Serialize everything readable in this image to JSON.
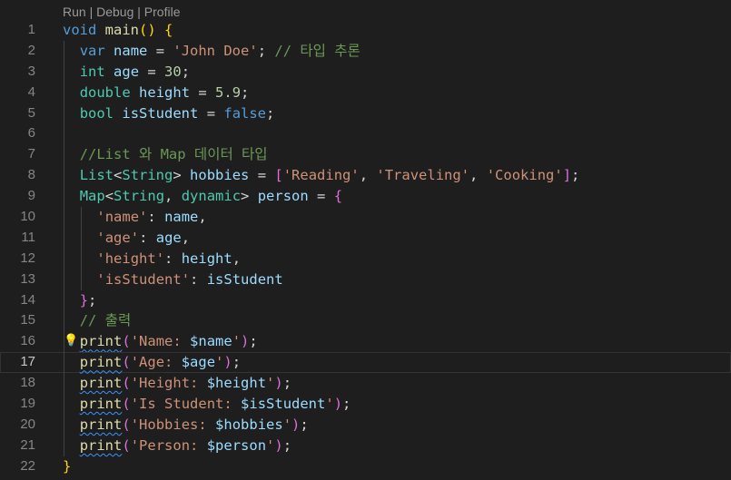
{
  "codelens": {
    "run": "Run",
    "debug": "Debug",
    "profile": "Profile",
    "sep": " | "
  },
  "current_line": 17,
  "lines": [
    {
      "n": "1",
      "tokens": [
        [
          "kw",
          "void"
        ],
        [
          "pu",
          " "
        ],
        [
          "fn",
          "main"
        ],
        [
          "br1",
          "()"
        ],
        [
          "pu",
          " "
        ],
        [
          "br1",
          "{"
        ]
      ]
    },
    {
      "n": "2",
      "indent": 1,
      "tokens": [
        [
          "kw",
          "var"
        ],
        [
          "pu",
          " "
        ],
        [
          "va",
          "name"
        ],
        [
          "pu",
          " = "
        ],
        [
          "st",
          "'John Doe'"
        ],
        [
          "pu",
          "; "
        ],
        [
          "cm",
          "// 타입 추론"
        ]
      ]
    },
    {
      "n": "3",
      "indent": 1,
      "tokens": [
        [
          "ty",
          "int"
        ],
        [
          "pu",
          " "
        ],
        [
          "va",
          "age"
        ],
        [
          "pu",
          " = "
        ],
        [
          "nu",
          "30"
        ],
        [
          "pu",
          ";"
        ]
      ]
    },
    {
      "n": "4",
      "indent": 1,
      "tokens": [
        [
          "ty",
          "double"
        ],
        [
          "pu",
          " "
        ],
        [
          "va",
          "height"
        ],
        [
          "pu",
          " = "
        ],
        [
          "nu",
          "5.9"
        ],
        [
          "pu",
          ";"
        ]
      ]
    },
    {
      "n": "5",
      "indent": 1,
      "tokens": [
        [
          "ty",
          "bool"
        ],
        [
          "pu",
          " "
        ],
        [
          "va",
          "isStudent"
        ],
        [
          "pu",
          " = "
        ],
        [
          "kw",
          "false"
        ],
        [
          "pu",
          ";"
        ]
      ]
    },
    {
      "n": "6",
      "indent": 1,
      "tokens": []
    },
    {
      "n": "7",
      "indent": 1,
      "tokens": [
        [
          "cm",
          "//List 와 Map 데이터 타입"
        ]
      ]
    },
    {
      "n": "8",
      "indent": 1,
      "tokens": [
        [
          "ty",
          "List"
        ],
        [
          "pu",
          "<"
        ],
        [
          "ty",
          "String"
        ],
        [
          "pu",
          "> "
        ],
        [
          "va",
          "hobbies"
        ],
        [
          "pu",
          " = "
        ],
        [
          "br2",
          "["
        ],
        [
          "st",
          "'Reading'"
        ],
        [
          "pu",
          ", "
        ],
        [
          "st",
          "'Traveling'"
        ],
        [
          "pu",
          ", "
        ],
        [
          "st",
          "'Cooking'"
        ],
        [
          "br2",
          "]"
        ],
        [
          "pu",
          ";"
        ]
      ]
    },
    {
      "n": "9",
      "indent": 1,
      "tokens": [
        [
          "ty",
          "Map"
        ],
        [
          "pu",
          "<"
        ],
        [
          "ty",
          "String"
        ],
        [
          "pu",
          ", "
        ],
        [
          "ty",
          "dynamic"
        ],
        [
          "pu",
          "> "
        ],
        [
          "va",
          "person"
        ],
        [
          "pu",
          " = "
        ],
        [
          "br2",
          "{"
        ]
      ]
    },
    {
      "n": "10",
      "indent": 2,
      "tokens": [
        [
          "st",
          "'name'"
        ],
        [
          "pu",
          ": "
        ],
        [
          "va",
          "name"
        ],
        [
          "pu",
          ","
        ]
      ]
    },
    {
      "n": "11",
      "indent": 2,
      "tokens": [
        [
          "st",
          "'age'"
        ],
        [
          "pu",
          ": "
        ],
        [
          "va",
          "age"
        ],
        [
          "pu",
          ","
        ]
      ]
    },
    {
      "n": "12",
      "indent": 2,
      "tokens": [
        [
          "st",
          "'height'"
        ],
        [
          "pu",
          ": "
        ],
        [
          "va",
          "height"
        ],
        [
          "pu",
          ","
        ]
      ]
    },
    {
      "n": "13",
      "indent": 2,
      "tokens": [
        [
          "st",
          "'isStudent'"
        ],
        [
          "pu",
          ": "
        ],
        [
          "va",
          "isStudent"
        ]
      ]
    },
    {
      "n": "14",
      "indent": 1,
      "tokens": [
        [
          "br2",
          "}"
        ],
        [
          "pu",
          ";"
        ]
      ]
    },
    {
      "n": "15",
      "indent": 1,
      "tokens": [
        [
          "cm",
          "// 출력"
        ]
      ]
    },
    {
      "n": "16",
      "indent": 1,
      "bulb": true,
      "tokens": [
        [
          "fn squig",
          "print"
        ],
        [
          "br2",
          "("
        ],
        [
          "st",
          "'Name: "
        ],
        [
          "va",
          "$name"
        ],
        [
          "st",
          "'"
        ],
        [
          "br2",
          ")"
        ],
        [
          "pu",
          ";"
        ]
      ]
    },
    {
      "n": "17",
      "indent": 1,
      "tokens": [
        [
          "fn squig",
          "print"
        ],
        [
          "br2",
          "("
        ],
        [
          "st",
          "'Age: "
        ],
        [
          "va",
          "$age"
        ],
        [
          "st",
          "'"
        ],
        [
          "br2",
          ")"
        ],
        [
          "pu",
          ";"
        ]
      ]
    },
    {
      "n": "18",
      "indent": 1,
      "tokens": [
        [
          "fn squig",
          "print"
        ],
        [
          "br2",
          "("
        ],
        [
          "st",
          "'Height: "
        ],
        [
          "va",
          "$height"
        ],
        [
          "st",
          "'"
        ],
        [
          "br2",
          ")"
        ],
        [
          "pu",
          ";"
        ]
      ]
    },
    {
      "n": "19",
      "indent": 1,
      "tokens": [
        [
          "fn squig",
          "print"
        ],
        [
          "br2",
          "("
        ],
        [
          "st",
          "'Is Student: "
        ],
        [
          "va",
          "$isStudent"
        ],
        [
          "st",
          "'"
        ],
        [
          "br2",
          ")"
        ],
        [
          "pu",
          ";"
        ]
      ]
    },
    {
      "n": "20",
      "indent": 1,
      "tokens": [
        [
          "fn squig",
          "print"
        ],
        [
          "br2",
          "("
        ],
        [
          "st",
          "'Hobbies: "
        ],
        [
          "va",
          "$hobbies"
        ],
        [
          "st",
          "'"
        ],
        [
          "br2",
          ")"
        ],
        [
          "pu",
          ";"
        ]
      ]
    },
    {
      "n": "21",
      "indent": 1,
      "tokens": [
        [
          "fn squig",
          "print"
        ],
        [
          "br2",
          "("
        ],
        [
          "st",
          "'Person: "
        ],
        [
          "va",
          "$person"
        ],
        [
          "st",
          "'"
        ],
        [
          "br2",
          ")"
        ],
        [
          "pu",
          ";"
        ]
      ]
    },
    {
      "n": "22",
      "tokens": [
        [
          "br1",
          "}"
        ]
      ]
    }
  ]
}
